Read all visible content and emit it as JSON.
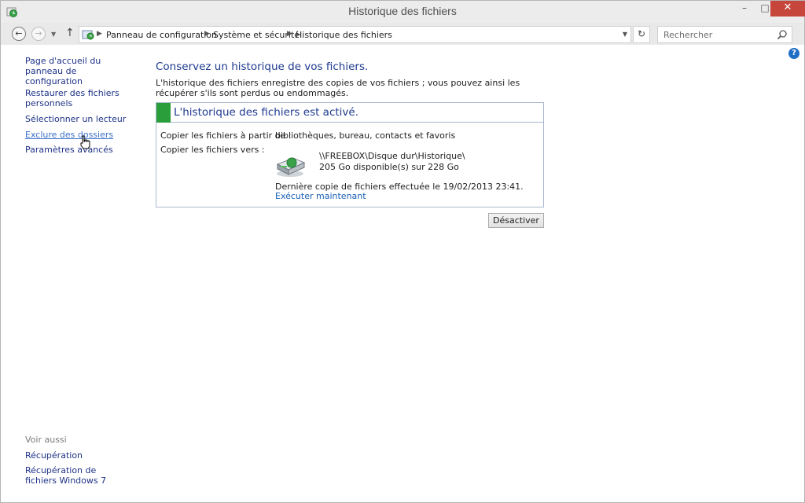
{
  "window": {
    "title": "Historique des fichiers",
    "controls": {
      "minimize": "–",
      "maximize": "□",
      "close": "✕"
    }
  },
  "nav": {
    "breadcrumb": [
      "Panneau de configuration",
      "Système et sécurité",
      "Historique des fichiers"
    ],
    "search_placeholder": "Rechercher"
  },
  "sidebar": {
    "links": [
      "Page d'accueil du panneau de configuration",
      "Restaurer des fichiers personnels",
      "Sélectionner un lecteur",
      "Exclure des dossiers",
      "Paramètres avancés"
    ],
    "see_also_label": "Voir aussi",
    "see_also": [
      "Récupération",
      "Récupération de fichiers Windows 7"
    ]
  },
  "main": {
    "heading": "Conservez un historique de vos fichiers.",
    "description": "L'historique des fichiers enregistre des copies de vos fichiers ; vous pouvez ainsi les récupérer s'ils sont perdus ou endommagés.",
    "status_title": "L'historique des fichiers est activé.",
    "copy_from_label": "Copier les fichiers à partir de :",
    "copy_from_value": "bibliothèques, bureau, contacts et favoris",
    "copy_to_label": "Copier les fichiers vers :",
    "drive_path": "\\\\FREEBOX\\Disque dur\\Historique\\",
    "drive_space": "205 Go disponible(s) sur 228 Go",
    "last_copy": "Dernière copie de fichiers effectuée le 19/02/2013 23:41.",
    "run_now": "Exécuter maintenant",
    "disable_button": "Désactiver"
  },
  "colors": {
    "status_green": "#2a9e3b",
    "link_blue": "#1e3287",
    "heading_blue": "#1e3a8f",
    "close_red": "#c7463c"
  }
}
